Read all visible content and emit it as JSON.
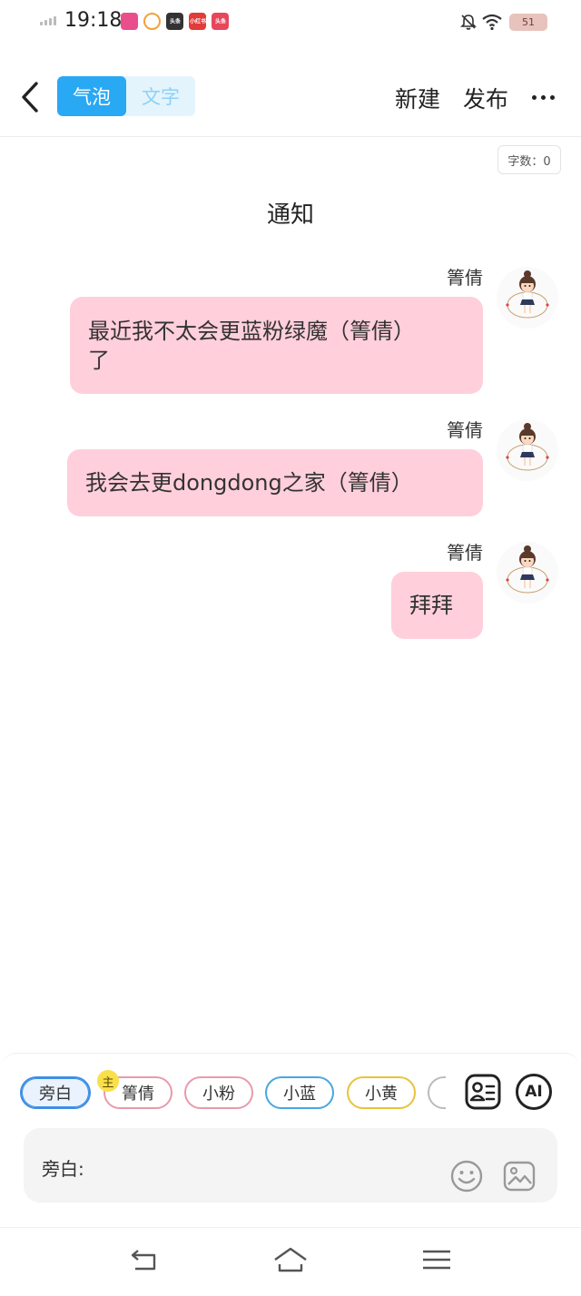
{
  "status_bar": {
    "time": "19:18",
    "battery": "51",
    "app_icons": [
      {
        "name": "bilibili-app-icon",
        "color": "#e84f8c",
        "label": ""
      },
      {
        "name": "video-app-icon",
        "color": "#ffffff",
        "label": ""
      },
      {
        "name": "toutiao-app-icon",
        "color": "#333333",
        "label": "头条"
      },
      {
        "name": "xiaohongshu-app-icon",
        "color": "#e33a3a",
        "label": "小红书"
      },
      {
        "name": "toutiao-red-app-icon",
        "color": "#e8475b",
        "label": "头条"
      }
    ]
  },
  "header": {
    "mode_tabs": [
      "气泡",
      "文字"
    ],
    "active_tab": "气泡",
    "new_label": "新建",
    "publish_label": "发布"
  },
  "word_count": "字数：0",
  "title": "通知",
  "messages": [
    {
      "sender": "箐倩",
      "text_lines": [
        "最近我不太会更蓝粉绿魔（箐倩）",
        "了"
      ]
    },
    {
      "sender": "箐倩",
      "text_lines": [
        "我会去更dongdong之家（箐倩）"
      ]
    },
    {
      "sender": "箐倩",
      "text_lines": [
        "拜拜"
      ]
    }
  ],
  "roles": [
    {
      "label": "旁白",
      "color": "#3d8ee6",
      "selected": true
    },
    {
      "label": "箐倩",
      "color": "#e89aac",
      "selected": false,
      "badge": "主"
    },
    {
      "label": "小粉",
      "color": "#e89aac",
      "selected": false
    },
    {
      "label": "小蓝",
      "color": "#4aa6e0",
      "selected": false
    },
    {
      "label": "小黄",
      "color": "#e8c33a",
      "selected": false
    }
  ],
  "role_list_button": "AI",
  "input": {
    "label": "旁白:"
  }
}
